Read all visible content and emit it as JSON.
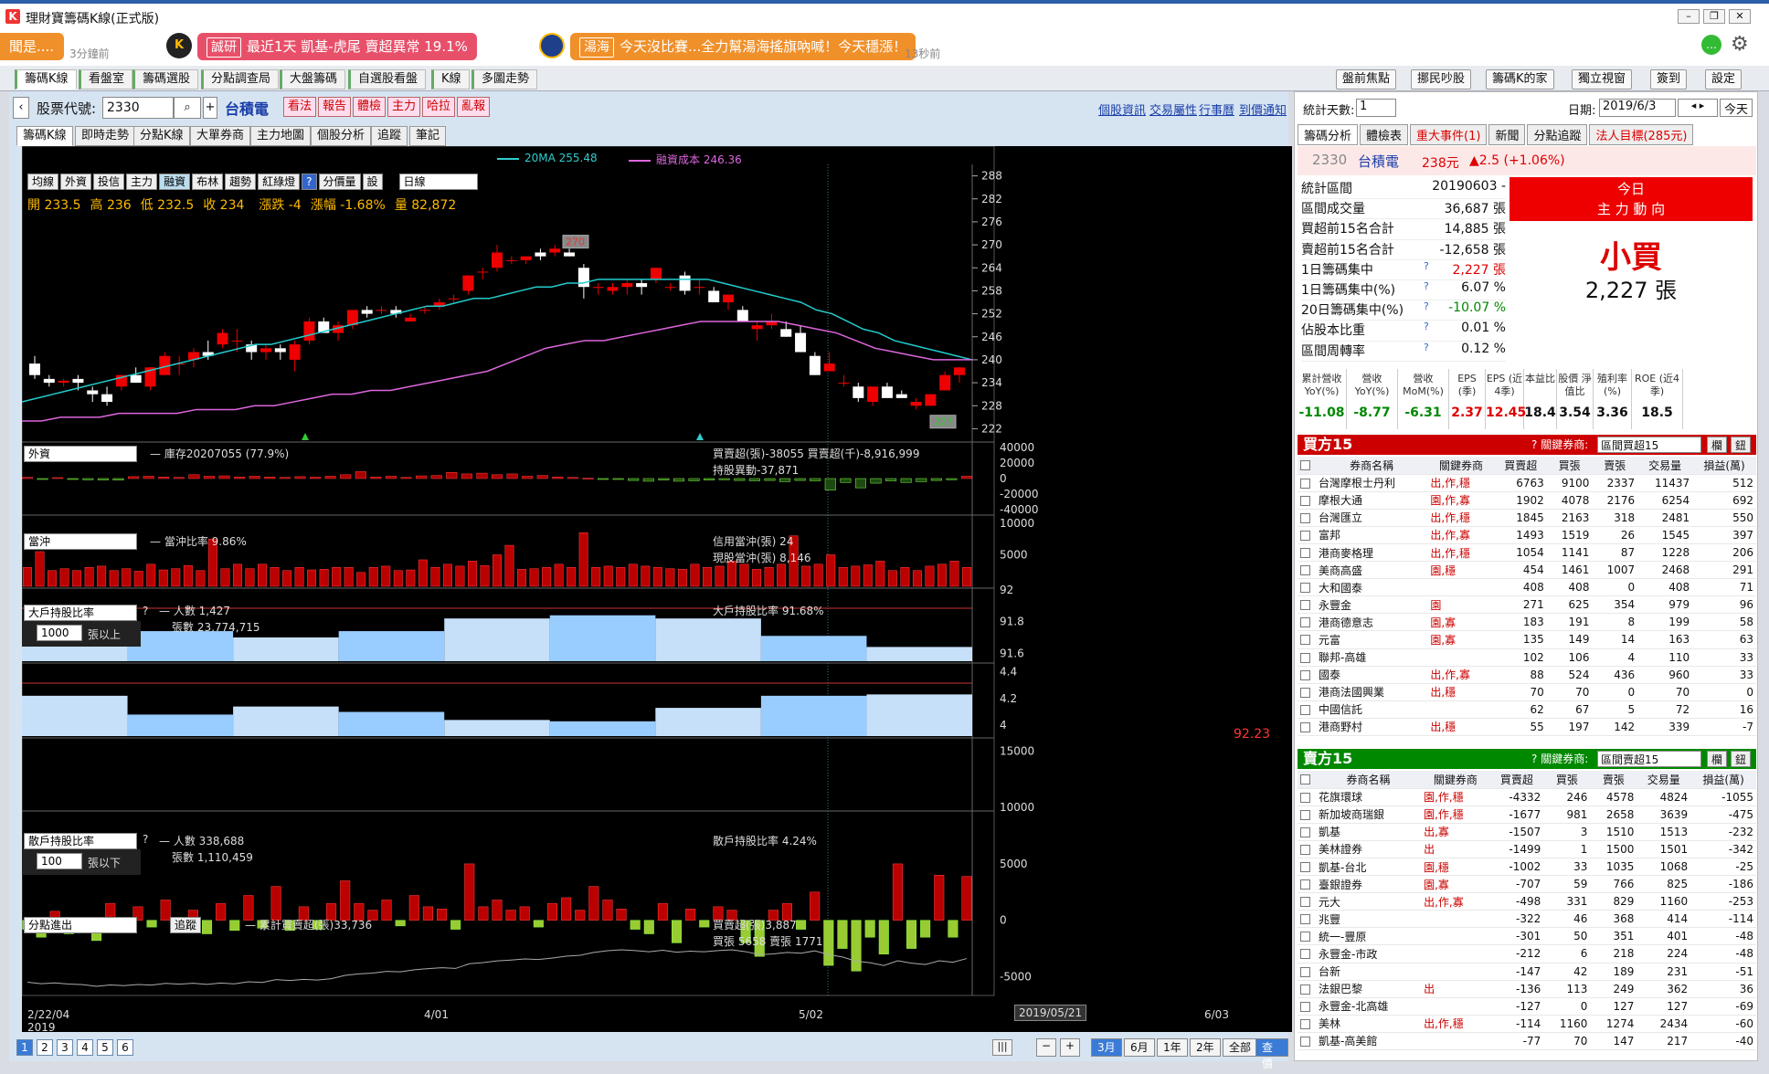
{
  "window": {
    "title": "理財寶籌碼K線(正式版)",
    "icon": "K"
  },
  "news": [
    {
      "text": "聞是....",
      "ago": "3分鐘前"
    },
    {
      "tag": "誠研",
      "text": "最近1天 凱基-虎尾 賣超異常 19.1%",
      "color": "#e8506a"
    },
    {
      "tag": "湯海",
      "text": "今天沒比賽...全力幫湯海搖旗吶喊！今天穩漲！",
      "ago": "13秒前",
      "color": "#f0902a"
    }
  ],
  "main_tabs": [
    "籌碼K線",
    "看盤室",
    "籌碼選股",
    "分點調查局",
    "大盤籌碼",
    "自選股看盤",
    "K線",
    "多圖走勢"
  ],
  "right_tools": [
    "盤前焦點",
    "挪民吵股",
    "籌碼K的家",
    "獨立視窗",
    "簽到",
    "設定"
  ],
  "stock": {
    "label": "股票代號:",
    "code": "2330",
    "name": "台積電",
    "actions": [
      "看法",
      "報告",
      "體檢",
      "主力",
      "哈拉",
      "亂報"
    ],
    "links": [
      "個股資訊",
      "交易屬性",
      "行事曆",
      "到價通知"
    ]
  },
  "sub_tabs": [
    "籌碼K線",
    "即時走勢",
    "分點K線",
    "大單券商",
    "主力地圖",
    "個股分析",
    "追蹤",
    "筆記"
  ],
  "chart_toolbar": {
    "buttons": [
      "均線",
      "外資",
      "投信",
      "主力",
      "融資",
      "布林",
      "趨勢",
      "紅綠燈",
      "?",
      "分價量",
      "設"
    ],
    "period": "日線"
  },
  "legend": {
    "ma": "20MA 255.48",
    "margin": "融資成本 246.36"
  },
  "ohlc": {
    "open": "開 233.5",
    "high": "高 236",
    "low": "低 232.5",
    "close": "收 234",
    "chg": "漲跌 -4",
    "pct": "漲幅 -1.68%",
    "vol": "量 82,872"
  },
  "chart_data": {
    "type": "candlestick",
    "price_axis": [
      288,
      282,
      276,
      270,
      264,
      258,
      252,
      246,
      240,
      234,
      228,
      222
    ],
    "high_label": "270",
    "low_label": "227",
    "x_labels": [
      "2/22/04",
      "4/01",
      "5/02",
      "2019/05/21",
      "6/03"
    ],
    "year": "2019",
    "candles": [
      [
        239,
        241,
        235,
        236
      ],
      [
        235,
        236,
        233,
        234
      ],
      [
        234,
        235,
        233,
        234.5
      ],
      [
        235,
        236,
        232,
        234
      ],
      [
        232,
        233,
        229,
        231
      ],
      [
        231,
        233,
        228,
        229
      ],
      [
        233,
        236,
        232,
        236
      ],
      [
        236,
        238,
        234,
        234
      ],
      [
        233,
        238,
        232,
        238
      ],
      [
        236,
        242,
        236,
        241
      ],
      [
        239,
        241,
        236,
        239
      ],
      [
        240,
        243,
        238,
        242
      ],
      [
        242,
        245,
        240,
        241
      ],
      [
        244,
        248,
        243,
        247
      ],
      [
        245,
        248,
        242,
        245
      ],
      [
        244,
        245,
        240,
        242
      ],
      [
        242,
        244,
        240,
        243
      ],
      [
        243,
        244,
        240,
        242
      ],
      [
        240,
        245,
        237,
        244
      ],
      [
        245,
        251,
        244,
        250
      ],
      [
        250,
        251,
        247,
        247
      ],
      [
        247,
        250,
        245,
        249
      ],
      [
        249,
        253,
        248,
        253
      ],
      [
        253,
        254,
        251,
        252
      ],
      [
        253,
        254,
        252,
        253
      ],
      [
        253,
        254,
        251,
        252
      ],
      [
        250,
        252,
        250,
        251
      ],
      [
        253,
        254,
        252,
        253
      ],
      [
        254,
        256,
        253,
        255
      ],
      [
        256,
        257,
        255,
        256
      ],
      [
        258,
        262,
        257,
        262
      ],
      [
        263,
        264,
        261,
        263
      ],
      [
        264,
        270,
        263,
        268
      ],
      [
        266,
        267,
        265,
        266
      ],
      [
        266,
        267,
        265,
        267
      ],
      [
        268,
        269,
        266,
        267
      ],
      [
        268,
        270,
        267,
        269
      ],
      [
        268,
        269,
        267,
        267
      ],
      [
        264,
        265,
        256,
        259
      ],
      [
        259,
        260,
        257,
        259
      ],
      [
        258,
        260,
        257,
        259
      ],
      [
        259,
        261,
        257,
        260
      ],
      [
        260,
        261,
        257,
        259
      ],
      [
        261,
        264,
        260,
        264
      ],
      [
        259,
        260,
        258,
        259
      ],
      [
        262,
        263,
        257,
        258
      ],
      [
        259,
        261,
        257,
        259
      ],
      [
        258,
        259,
        255,
        255
      ],
      [
        255,
        257,
        253,
        257
      ],
      [
        253,
        254,
        250,
        250
      ],
      [
        248,
        250,
        245,
        249
      ],
      [
        249,
        252,
        248,
        250
      ],
      [
        248,
        250,
        246,
        246
      ],
      [
        247,
        249,
        242,
        242
      ],
      [
        241,
        242,
        236,
        236
      ],
      [
        237,
        242,
        237,
        239
      ],
      [
        234,
        236,
        233,
        234
      ],
      [
        233,
        234,
        229,
        230
      ],
      [
        229,
        232,
        228,
        233
      ],
      [
        233,
        234,
        231,
        230
      ],
      [
        231,
        232,
        230,
        230
      ],
      [
        228,
        230,
        227,
        229
      ],
      [
        228,
        231,
        228,
        231
      ],
      [
        232,
        237,
        232,
        236
      ],
      [
        236,
        238,
        234,
        238
      ]
    ],
    "ma20": [
      229,
      230,
      231,
      232,
      233,
      234,
      235,
      236,
      237,
      238,
      239,
      240,
      241,
      242,
      243,
      244,
      244,
      245,
      246,
      247,
      248,
      249,
      250,
      251,
      252,
      253,
      254,
      254,
      255,
      256,
      256,
      257,
      258,
      259,
      259,
      260,
      260,
      261,
      261,
      261,
      261,
      261,
      261,
      261,
      261,
      260,
      259,
      258,
      257,
      256,
      255,
      253,
      252,
      250,
      248,
      247,
      245,
      244,
      243,
      242,
      241,
      240
    ],
    "margin_cost": [
      224,
      224,
      225,
      225,
      225,
      226,
      226,
      226,
      226,
      227,
      227,
      227,
      228,
      228,
      229,
      230,
      231,
      231,
      232,
      232,
      233,
      234,
      235,
      236,
      237,
      239,
      241,
      243,
      244,
      245,
      245,
      246,
      247,
      248,
      249,
      250,
      250,
      250,
      250,
      250,
      249,
      248,
      247,
      245,
      243,
      242,
      241,
      240,
      240,
      240
    ]
  },
  "foreign": {
    "selector": "外資",
    "stock": "庫存20207055 (77.9%)",
    "net": "買賣超(張)-38055 買賣超(千)-8,916,999",
    "change": "持股異動-37,871",
    "axis": [
      "40000",
      "20000",
      "0",
      "-20000",
      "-40000"
    ],
    "values": [
      1500,
      -500,
      1200,
      -1000,
      -1500,
      -1800,
      -2000,
      2500,
      3000,
      2000,
      1500,
      5000,
      3000,
      3500,
      2000,
      3000,
      2000,
      1500,
      2500,
      1800,
      3000,
      5000,
      9000,
      2000,
      3000,
      1500,
      3500,
      4000,
      8000,
      6000,
      7000,
      5000,
      6000,
      3000,
      4000,
      2000,
      1500,
      500,
      -600,
      -1000,
      -2500,
      -3500,
      -2000,
      -3500,
      -3000,
      -2000,
      -1500,
      -2500,
      -3000,
      -2500,
      -4000,
      -2500,
      -3000,
      -15000,
      -5000,
      -12000,
      -6000,
      -3000,
      -5000,
      -4000,
      -2500,
      -1500,
      3000
    ]
  },
  "daytrade": {
    "selector": "當沖",
    "ratio": "當沖比率 9.86%",
    "credit": "信用當沖(張) 24",
    "cash": "現股當沖(張) 8,146",
    "axis": [
      "10000",
      "5000"
    ],
    "values": [
      3000,
      5500,
      2500,
      2800,
      2500,
      3000,
      3200,
      2500,
      2800,
      2400,
      3500,
      2600,
      2800,
      3300,
      2500,
      7500,
      2800,
      3500,
      2800,
      3500,
      3000,
      2500,
      3000,
      2600,
      2700,
      3000,
      3000,
      2200,
      3000,
      3200,
      2500,
      2600,
      4200,
      3000,
      3500,
      3200,
      4000,
      3300,
      5000,
      6500,
      2700,
      2800,
      3000,
      3500,
      3000,
      8500,
      3000,
      3200,
      3000,
      3500,
      3200,
      3000,
      2800,
      2700,
      3500,
      3000,
      3200,
      4000,
      3500,
      2700,
      3000,
      3500,
      8000,
      3200,
      3500,
      5000,
      3000,
      3200,
      3400,
      4000,
      2500,
      3000,
      2500,
      3200,
      3500,
      4000,
      3000
    ]
  },
  "big_holder": {
    "selector": "大戶持股比率",
    "threshold": "1000",
    "unit": "張以上",
    "people": "人數 1,427",
    "lots": "張數 23,774,715",
    "ratio": "大戶持股比率 91.68%",
    "axis": [
      "92",
      "91.8",
      "91.6"
    ],
    "current": "92.23",
    "weekly": [
      91.66,
      91.74,
      91.7,
      91.74,
      91.82,
      91.84,
      91.82,
      91.71,
      91.64
    ]
  },
  "retail": {
    "selector": "散戶持股比率",
    "threshold": "100",
    "unit": "張以下",
    "people": "人數 338,688",
    "lots": "張數 1,110,459",
    "ratio": "散戶持股比率 4.24%",
    "axis": [
      "4.4",
      "4.2",
      "4"
    ],
    "weekly": [
      4.22,
      4.08,
      4.14,
      4.1,
      4.04,
      4.03,
      4.13,
      4.22,
      4.23
    ]
  },
  "branch": {
    "selector": "分點進出",
    "track": "追蹤",
    "cum": "累計買賣超(張)33,736",
    "net": "買賣超(張)3,887",
    "detail": "買張 5658 賣張 1771",
    "axis": [
      "15000",
      "10000",
      "5000",
      "0",
      "-5000"
    ],
    "values": [
      -800,
      -1500,
      800,
      -1200,
      -600,
      -1800,
      1500,
      -800,
      1200,
      -600,
      1800,
      -800,
      900,
      -1200,
      1500,
      -900,
      2200,
      -700,
      3000,
      -900,
      1200,
      -800,
      1500,
      3500,
      1500,
      900,
      1800,
      -500,
      2200,
      1200,
      1000,
      -800,
      5000,
      1200,
      1800,
      900,
      1200,
      -600,
      1500,
      2000,
      900,
      3000,
      1800,
      1000,
      -800,
      -1200,
      1500,
      -2000,
      1000,
      -600,
      1200,
      900,
      -2000,
      -3200,
      900,
      1500,
      -800,
      2500,
      -4000,
      -2500,
      -4500,
      -1500,
      -3000,
      5000,
      -2500,
      -1500,
      4000,
      -1500,
      3887
    ]
  },
  "bottom": {
    "pages": [
      "1",
      "2",
      "3",
      "4",
      "5",
      "6"
    ],
    "ranges": [
      "3月",
      "6月",
      "1年",
      "2年",
      "全部",
      "查價"
    ],
    "date_marker": "2019/05/21"
  },
  "right": {
    "stat_days_label": "統計天數:",
    "stat_days": "1",
    "date_label": "日期:",
    "date": "2019/6/3",
    "today": "今天",
    "tabs": [
      "籌碼分析",
      "體檢表",
      "重大事件(1)",
      "新聞",
      "分點追蹤",
      "法人目標(285元)"
    ],
    "header": {
      "code": "2330",
      "name": "台積電",
      "price": "238元",
      "chg": "▲2.5 (+1.06%)"
    },
    "stats": [
      [
        "統計區間",
        "20190603 -"
      ],
      [
        "區間成交量",
        "36,687 張"
      ],
      [
        "買超前15名合計",
        "14,885 張"
      ],
      [
        "賣超前15名合計",
        "-12,658 張"
      ],
      [
        "1日籌碼集中",
        "2,227 張"
      ],
      [
        "1日籌碼集中(%)",
        "6.07 %"
      ],
      [
        "20日籌碼集中(%)",
        "-10.07 %"
      ],
      [
        "佔股本比重",
        "0.01 %"
      ],
      [
        "區間周轉率",
        "0.12 %"
      ]
    ],
    "direction": {
      "title1": "今日",
      "title2": "主 力 動 向",
      "main": "小買",
      "sub": "2,227 張"
    },
    "fin": [
      [
        "累計營收 YoY(%)",
        "-11.08"
      ],
      [
        "營收 YoY(%)",
        "-8.77"
      ],
      [
        "營收 MoM(%)",
        "-6.31"
      ],
      [
        "EPS (季)",
        "2.37"
      ],
      [
        "EPS (近4季)",
        "12.45"
      ],
      [
        "本益比",
        "18.4"
      ],
      [
        "股價 淨值比",
        "3.54"
      ],
      [
        "殖利率 (%)",
        "3.36"
      ],
      [
        "ROE (近4季)",
        "18.5"
      ]
    ],
    "buy": {
      "title": "買方15",
      "sel_label": "關鍵券商:",
      "sel": "區間買超15",
      "btns": [
        "欄",
        "鈕"
      ],
      "cols": [
        "券商名稱",
        "關鍵券商",
        "買賣超",
        "買張",
        "賣張",
        "交易量",
        "損益(萬)"
      ],
      "rows": [
        [
          "台灣摩根士丹利",
          "出,作,穩",
          "6763",
          "9100",
          "2337",
          "11437",
          "512"
        ],
        [
          "摩根大通",
          "園,作,寡",
          "1902",
          "4078",
          "2176",
          "6254",
          "692"
        ],
        [
          "台灣匯立",
          "出,作,穩",
          "1845",
          "2163",
          "318",
          "2481",
          "550"
        ],
        [
          "富邦",
          "出,作,寡",
          "1493",
          "1519",
          "26",
          "1545",
          "397"
        ],
        [
          "港商麥格理",
          "出,作,穩",
          "1054",
          "1141",
          "87",
          "1228",
          "206"
        ],
        [
          "美商高盛",
          "園,穩",
          "454",
          "1461",
          "1007",
          "2468",
          "291"
        ],
        [
          "大和國泰",
          "",
          "408",
          "408",
          "0",
          "408",
          "71"
        ],
        [
          "永豐金",
          "園",
          "271",
          "625",
          "354",
          "979",
          "96"
        ],
        [
          "港商德意志",
          "園,寡",
          "183",
          "191",
          "8",
          "199",
          "58"
        ],
        [
          "元富",
          "園,寡",
          "135",
          "149",
          "14",
          "163",
          "63"
        ],
        [
          "聯邦-高雄",
          "",
          "102",
          "106",
          "4",
          "110",
          "33"
        ],
        [
          "國泰",
          "出,作,寡",
          "88",
          "524",
          "436",
          "960",
          "33"
        ],
        [
          "港商法國興業",
          "出,穩",
          "70",
          "70",
          "0",
          "70",
          "0"
        ],
        [
          "中國信託",
          "",
          "62",
          "67",
          "5",
          "72",
          "16"
        ],
        [
          "港商野村",
          "出,穩",
          "55",
          "197",
          "142",
          "339",
          "-7"
        ]
      ]
    },
    "sell": {
      "title": "賣方15",
      "sel_label": "關鍵券商:",
      "sel": "區間賣超15",
      "btns": [
        "欄",
        "鈕"
      ],
      "cols": [
        "券商名稱",
        "關鍵券商",
        "買賣超",
        "買張",
        "賣張",
        "交易量",
        "損益(萬)"
      ],
      "rows": [
        [
          "花旗環球",
          "園,作,穩",
          "-4332",
          "246",
          "4578",
          "4824",
          "-1055"
        ],
        [
          "新加坡商瑞銀",
          "園,作,穩",
          "-1677",
          "981",
          "2658",
          "3639",
          "-475"
        ],
        [
          "凱基",
          "出,寡",
          "-1507",
          "3",
          "1510",
          "1513",
          "-232"
        ],
        [
          "美林證券",
          "出",
          "-1499",
          "1",
          "1500",
          "1501",
          "-342"
        ],
        [
          "凱基-台北",
          "園,穩",
          "-1002",
          "33",
          "1035",
          "1068",
          "-25"
        ],
        [
          "臺銀證券",
          "園,寡",
          "-707",
          "59",
          "766",
          "825",
          "-186"
        ],
        [
          "元大",
          "出,作,寡",
          "-498",
          "331",
          "829",
          "1160",
          "-253"
        ],
        [
          "兆豐",
          "",
          "-322",
          "46",
          "368",
          "414",
          "-114"
        ],
        [
          "統一-豐原",
          "",
          "-301",
          "50",
          "351",
          "401",
          "-48"
        ],
        [
          "永豐金-市政",
          "",
          "-212",
          "6",
          "218",
          "224",
          "-48"
        ],
        [
          "台新",
          "",
          "-147",
          "42",
          "189",
          "231",
          "-51"
        ],
        [
          "法銀巴黎",
          "出",
          "-136",
          "113",
          "249",
          "362",
          "36"
        ],
        [
          "永豐金-北高雄",
          "",
          "-127",
          "0",
          "127",
          "127",
          "-69"
        ],
        [
          "美林",
          "出,作,穩",
          "-114",
          "1160",
          "1274",
          "2434",
          "-60"
        ],
        [
          "凱基-高美館",
          "",
          "-77",
          "70",
          "147",
          "217",
          "-40"
        ]
      ]
    }
  }
}
